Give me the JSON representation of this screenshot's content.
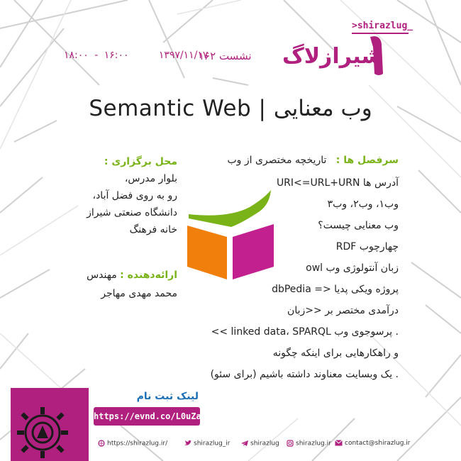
{
  "header": {
    "brand_tag": ">shirazlug_",
    "logo_name": "شیرازلاگ",
    "session": "نشست ۱۶۲",
    "time": "۱۶:۰۰ - ۱۸:۰۰",
    "date": "۱۳۹۷/۱۱/۱۷"
  },
  "title": "Semantic Web | وب معنایی",
  "topics": {
    "label": "سرفصل ها :",
    "first": "تاریخچه مختصری از وب",
    "items": [
      "آدرس ها URI<=URL+URN",
      "وب۱، وب۲، وب۳",
      "وب معنایی چیست؟",
      "چهارچوب RDF",
      "زبان آنتولوژی وب owl",
      "پروژه ویکی پدیا <= dbPedia",
      "درآمدی مختصر بر <<زبان",
      ". پرسوجوی وب linked data، SPARQL >>",
      "و راهکارهایی برای اینکه چگونه",
      ". یک وبسایت معناوند داشته باشیم (برای سئو)"
    ]
  },
  "venue": {
    "label": "محل برگزاری :",
    "lines": [
      "بلوار مدرس،",
      "رو به روی فضل آباد،",
      "دانشگاه صنعتی شیراز",
      "خانه فرهنگ"
    ]
  },
  "presenter": {
    "label": "ارائه‌دهنده :",
    "title": "مهندس",
    "name": "محمد مهدی مهاجر"
  },
  "register": {
    "label": "لینک ثبت نام",
    "url": "https://evnd.co/L0uZa"
  },
  "footer": {
    "website": "https://shirazlug.ir/",
    "twitter": "shirazlug_ir",
    "telegram": "shirazlug",
    "instagram": "shirazlug.ir",
    "email": "contact@shirazlug.ir"
  },
  "colors": {
    "brand": "#b0207f",
    "accent_green": "#7ab317",
    "link_blue": "#1a6fb5",
    "cube_orange": "#f07f0c",
    "cube_magenta": "#c21f8f",
    "cube_green": "#7ab317"
  },
  "icons": [
    "globe-icon",
    "twitter-icon",
    "telegram-icon",
    "instagram-icon",
    "email-icon",
    "gear-icon",
    "semantic-web-cube-icon"
  ]
}
